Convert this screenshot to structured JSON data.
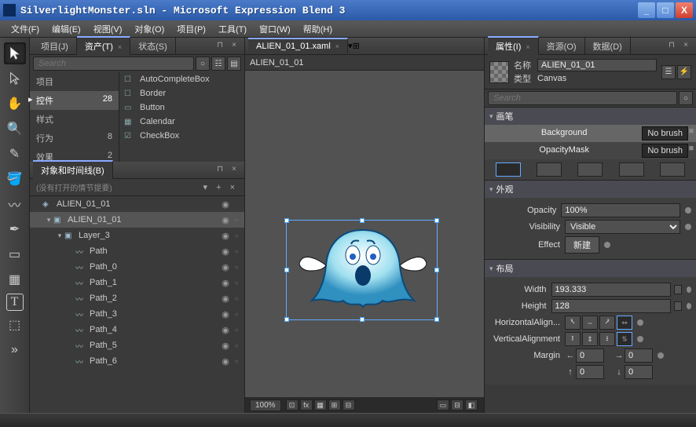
{
  "window": {
    "title": "SilverlightMonster.sln - Microsoft Expression Blend 3"
  },
  "menu": [
    "文件(F)",
    "编辑(E)",
    "视图(V)",
    "对象(O)",
    "项目(P)",
    "工具(T)",
    "窗口(W)",
    "帮助(H)"
  ],
  "left_tabs": {
    "project": "项目(J)",
    "assets": "资产(T)",
    "states": "状态(S)"
  },
  "search_placeholder": "Search",
  "asset_cats": [
    {
      "label": "项目",
      "count": ""
    },
    {
      "label": "控件",
      "count": "28"
    },
    {
      "label": "样式",
      "count": ""
    },
    {
      "label": "行为",
      "count": "8"
    },
    {
      "label": "效果",
      "count": "2"
    }
  ],
  "asset_items": [
    {
      "icon": "☐",
      "label": "AutoCompleteBox"
    },
    {
      "icon": "☐",
      "label": "Border"
    },
    {
      "icon": "▭",
      "label": "Button"
    },
    {
      "icon": "▦",
      "label": "Calendar"
    },
    {
      "icon": "☑",
      "label": "CheckBox"
    }
  ],
  "objtl_title": "对象和时间线(B)",
  "objtl_sub": "(没有打开的情节提要)",
  "tree": [
    {
      "depth": 0,
      "toggle": "",
      "icon": "◈",
      "label": "ALIEN_01_01",
      "eye": true,
      "dot": false,
      "sel": false
    },
    {
      "depth": 1,
      "toggle": "▾",
      "icon": "▣",
      "label": "ALIEN_01_01",
      "eye": true,
      "dot": true,
      "sel": true
    },
    {
      "depth": 2,
      "toggle": "▾",
      "icon": "▣",
      "label": "Layer_3",
      "eye": true,
      "dot": true,
      "sel": false
    },
    {
      "depth": 3,
      "toggle": "",
      "icon": "〰",
      "label": "Path",
      "eye": true,
      "dot": true,
      "sel": false
    },
    {
      "depth": 3,
      "toggle": "",
      "icon": "〰",
      "label": "Path_0",
      "eye": true,
      "dot": true,
      "sel": false
    },
    {
      "depth": 3,
      "toggle": "",
      "icon": "〰",
      "label": "Path_1",
      "eye": true,
      "dot": true,
      "sel": false
    },
    {
      "depth": 3,
      "toggle": "",
      "icon": "〰",
      "label": "Path_2",
      "eye": true,
      "dot": true,
      "sel": false
    },
    {
      "depth": 3,
      "toggle": "",
      "icon": "〰",
      "label": "Path_3",
      "eye": true,
      "dot": true,
      "sel": false
    },
    {
      "depth": 3,
      "toggle": "",
      "icon": "〰",
      "label": "Path_4",
      "eye": true,
      "dot": true,
      "sel": false
    },
    {
      "depth": 3,
      "toggle": "",
      "icon": "〰",
      "label": "Path_5",
      "eye": true,
      "dot": true,
      "sel": false
    },
    {
      "depth": 3,
      "toggle": "",
      "icon": "〰",
      "label": "Path_6",
      "eye": true,
      "dot": true,
      "sel": false
    }
  ],
  "doc_tab": "ALIEN_01_01.xaml",
  "breadcrumb": "ALIEN_01_01",
  "zoom": "100%",
  "right_tabs": {
    "props": "属性(I)",
    "resources": "资源(O)",
    "data": "数据(D)"
  },
  "props": {
    "name_label": "名称",
    "name_value": "ALIEN_01_01",
    "type_label": "类型",
    "type_value": "Canvas",
    "sections": {
      "brush": "画笔",
      "appearance": "外观",
      "layout": "布局"
    },
    "brush": {
      "background_label": "Background",
      "background_value": "No brush",
      "opacitymask_label": "OpacityMask",
      "opacitymask_value": "No brush"
    },
    "appearance": {
      "opacity_label": "Opacity",
      "opacity_value": "100%",
      "visibility_label": "Visibility",
      "visibility_value": "Visible",
      "effect_label": "Effect",
      "effect_button": "新建"
    },
    "layout": {
      "width_label": "Width",
      "width_value": "193.333",
      "height_label": "Height",
      "height_value": "128",
      "halign_label": "HorizontalAlign...",
      "valign_label": "VerticalAlignment",
      "margin_label": "Margin",
      "margin_l": "0",
      "margin_r": "0",
      "margin_t": "0",
      "margin_b": "0"
    }
  }
}
